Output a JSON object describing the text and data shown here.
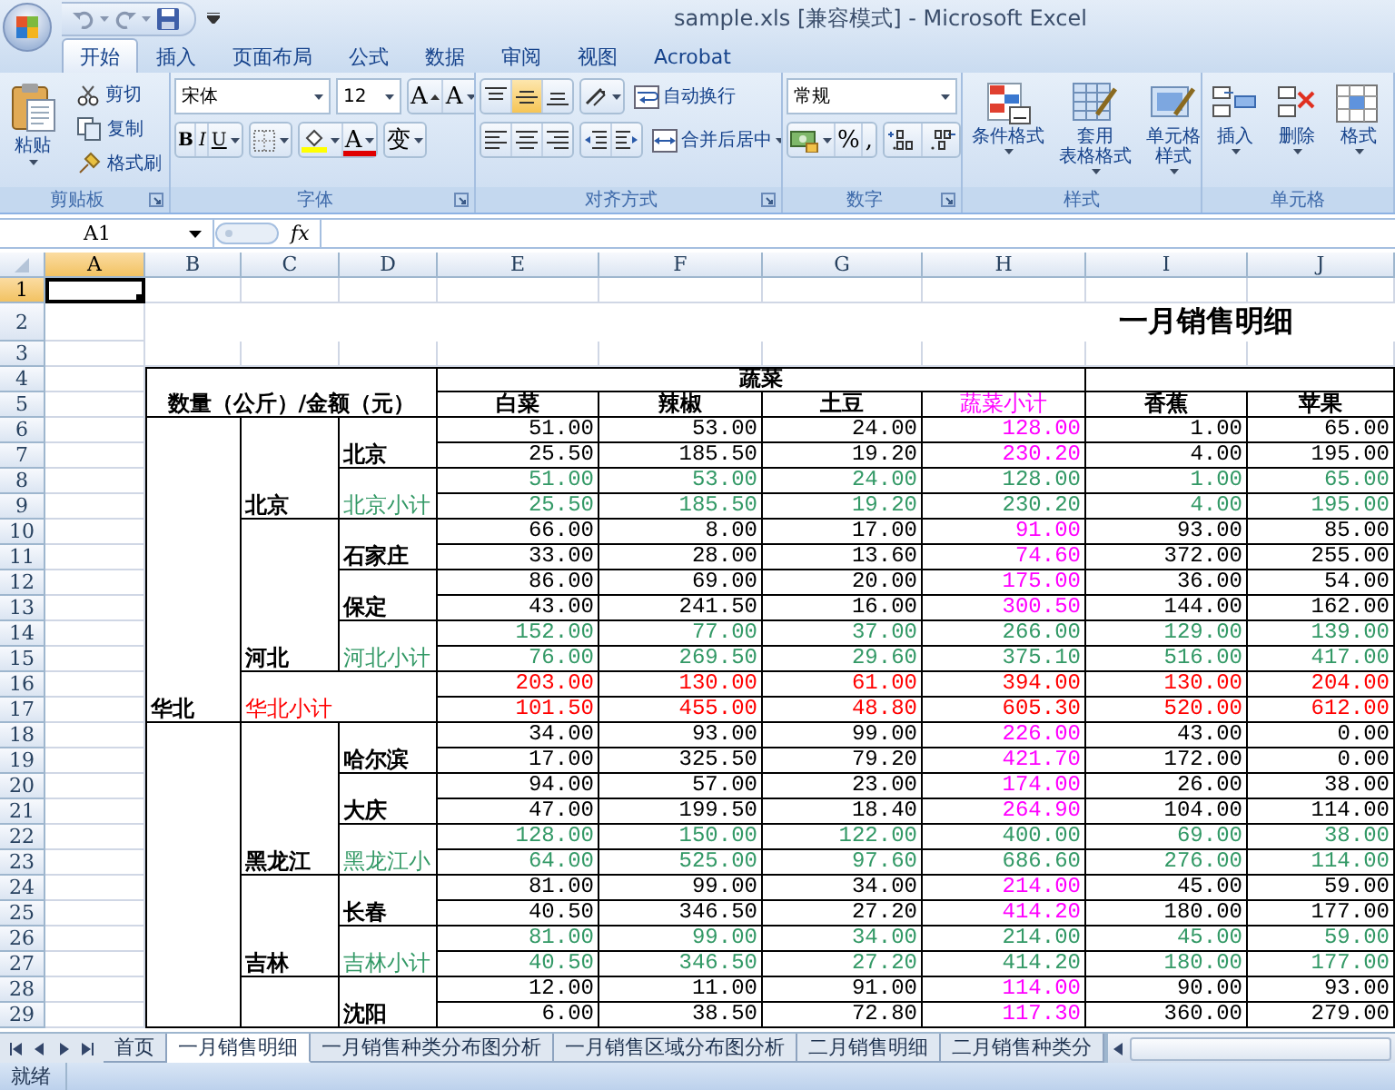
{
  "window": {
    "title": "sample.xls [兼容模式] - Microsoft Excel"
  },
  "ribbon_tabs": [
    {
      "label": "开始",
      "selected": true
    },
    {
      "label": "插入",
      "selected": false
    },
    {
      "label": "页面布局",
      "selected": false
    },
    {
      "label": "公式",
      "selected": false
    },
    {
      "label": "数据",
      "selected": false
    },
    {
      "label": "审阅",
      "selected": false
    },
    {
      "label": "视图",
      "selected": false
    },
    {
      "label": "Acrobat",
      "selected": false
    }
  ],
  "ribbon": {
    "groups": [
      {
        "kind": "clipboard",
        "label": "剪贴板",
        "launcher": true,
        "paste": "粘贴",
        "small": [
          "剪切",
          "复制",
          "格式刷"
        ]
      },
      {
        "kind": "font",
        "label": "字体",
        "launcher": true,
        "font_name": "宋体",
        "font_size": "12",
        "grow": "A",
        "shrink": "A",
        "bold": "B",
        "italic": "I",
        "underline": "U",
        "font_color": "A",
        "phonetic": "变"
      },
      {
        "kind": "alignment",
        "label": "对齐方式",
        "launcher": true,
        "vertical": [
          {
            "selected": false
          },
          {
            "selected": true
          },
          {
            "selected": false
          }
        ],
        "wrap": "自动换行",
        "merge": "合并后居中"
      },
      {
        "kind": "number",
        "label": "数字",
        "launcher": true,
        "format": "常规",
        "percent": "%",
        "comma": ","
      },
      {
        "kind": "styles",
        "label": "样式",
        "launcher": false,
        "buttons": [
          [
            "条件格式"
          ],
          [
            "套用",
            "表格格式"
          ],
          [
            "单元格",
            "样式"
          ]
        ]
      },
      {
        "kind": "cells",
        "label": "单元格",
        "launcher": false,
        "buttons": [
          [
            "插入"
          ],
          [
            "删除"
          ],
          [
            "格式"
          ]
        ]
      }
    ]
  },
  "formula_bar": {
    "name_box": "A1",
    "function_label": "fx"
  },
  "sheet": {
    "columns": [
      {
        "label": "A",
        "selected": true
      },
      {
        "label": "B",
        "selected": false
      },
      {
        "label": "C",
        "selected": false
      },
      {
        "label": "D",
        "selected": false
      },
      {
        "label": "E",
        "selected": false
      },
      {
        "label": "F",
        "selected": false
      },
      {
        "label": "G",
        "selected": false
      },
      {
        "label": "H",
        "selected": false
      },
      {
        "label": "I",
        "selected": false
      },
      {
        "label": "J",
        "selected": false
      }
    ],
    "rows": [
      {
        "label": "1",
        "selected": true
      },
      {
        "label": "2",
        "selected": false
      },
      {
        "label": "3",
        "selected": false
      },
      {
        "label": "4",
        "selected": false
      },
      {
        "label": "5",
        "selected": false
      },
      {
        "label": "6",
        "selected": false
      },
      {
        "label": "7",
        "selected": false
      },
      {
        "label": "8",
        "selected": false
      },
      {
        "label": "9",
        "selected": false
      },
      {
        "label": "10",
        "selected": false
      },
      {
        "label": "11",
        "selected": false
      },
      {
        "label": "12",
        "selected": false
      },
      {
        "label": "13",
        "selected": false
      },
      {
        "label": "14",
        "selected": false
      },
      {
        "label": "15",
        "selected": false
      },
      {
        "label": "16",
        "selected": false
      },
      {
        "label": "17",
        "selected": false
      },
      {
        "label": "18",
        "selected": false
      },
      {
        "label": "19",
        "selected": false
      },
      {
        "label": "20",
        "selected": false
      },
      {
        "label": "21",
        "selected": false
      },
      {
        "label": "22",
        "selected": false
      },
      {
        "label": "23",
        "selected": false
      },
      {
        "label": "24",
        "selected": false
      },
      {
        "label": "25",
        "selected": false
      },
      {
        "label": "26",
        "selected": false
      },
      {
        "label": "27",
        "selected": false
      },
      {
        "label": "28",
        "selected": false
      },
      {
        "label": "29",
        "selected": false
      }
    ],
    "title": "一月销售明细",
    "corner_label": "数量（公斤）/金额（元）",
    "product_groups": [
      {
        "label": "蔬菜"
      }
    ],
    "headers": [
      {
        "label": "白菜",
        "kind": "item"
      },
      {
        "label": "辣椒",
        "kind": "item"
      },
      {
        "label": "土豆",
        "kind": "item"
      },
      {
        "label": "蔬菜小计",
        "kind": "subtotal"
      },
      {
        "label": "香蕉",
        "kind": "item"
      },
      {
        "label": "苹果",
        "kind": "item"
      }
    ],
    "regions": [
      {
        "name": "华北",
        "provinces": [
          {
            "name": "北京",
            "cities": [
              {
                "name": "北京",
                "quantity": [
                  "51.00",
                  "53.00",
                  "24.00",
                  "128.00",
                  "1.00",
                  "65.00"
                ],
                "amount": [
                  "25.50",
                  "185.50",
                  "19.20",
                  "230.20",
                  "4.00",
                  "195.00"
                ]
              }
            ],
            "subtotal": {
              "label": "北京小计",
              "quantity": [
                "51.00",
                "53.00",
                "24.00",
                "128.00",
                "1.00",
                "65.00"
              ],
              "amount": [
                "25.50",
                "185.50",
                "19.20",
                "230.20",
                "4.00",
                "195.00"
              ]
            }
          },
          {
            "name": "河北",
            "cities": [
              {
                "name": "石家庄",
                "quantity": [
                  "66.00",
                  "8.00",
                  "17.00",
                  "91.00",
                  "93.00",
                  "85.00"
                ],
                "amount": [
                  "33.00",
                  "28.00",
                  "13.60",
                  "74.60",
                  "372.00",
                  "255.00"
                ]
              },
              {
                "name": "保定",
                "quantity": [
                  "86.00",
                  "69.00",
                  "20.00",
                  "175.00",
                  "36.00",
                  "54.00"
                ],
                "amount": [
                  "43.00",
                  "241.50",
                  "16.00",
                  "300.50",
                  "144.00",
                  "162.00"
                ]
              }
            ],
            "subtotal": {
              "label": "河北小计",
              "quantity": [
                "152.00",
                "77.00",
                "37.00",
                "266.00",
                "129.00",
                "139.00"
              ],
              "amount": [
                "76.00",
                "269.50",
                "29.60",
                "375.10",
                "516.00",
                "417.00"
              ]
            }
          }
        ],
        "total": {
          "label": "华北小计",
          "quantity": [
            "203.00",
            "130.00",
            "61.00",
            "394.00",
            "130.00",
            "204.00"
          ],
          "amount": [
            "101.50",
            "455.00",
            "48.80",
            "605.30",
            "520.00",
            "612.00"
          ]
        }
      },
      {
        "provinces": [
          {
            "name": "黑龙江",
            "cities": [
              {
                "name": "哈尔滨",
                "quantity": [
                  "34.00",
                  "93.00",
                  "99.00",
                  "226.00",
                  "43.00",
                  "0.00"
                ],
                "amount": [
                  "17.00",
                  "325.50",
                  "79.20",
                  "421.70",
                  "172.00",
                  "0.00"
                ]
              },
              {
                "name": "大庆",
                "quantity": [
                  "94.00",
                  "57.00",
                  "23.00",
                  "174.00",
                  "26.00",
                  "38.00"
                ],
                "amount": [
                  "47.00",
                  "199.50",
                  "18.40",
                  "264.90",
                  "104.00",
                  "114.00"
                ]
              }
            ],
            "subtotal": {
              "label": "黑龙江小",
              "quantity": [
                "128.00",
                "150.00",
                "122.00",
                "400.00",
                "69.00",
                "38.00"
              ],
              "amount": [
                "64.00",
                "525.00",
                "97.60",
                "686.60",
                "276.00",
                "114.00"
              ]
            }
          },
          {
            "name": "吉林",
            "cities": [
              {
                "name": "长春",
                "quantity": [
                  "81.00",
                  "99.00",
                  "34.00",
                  "214.00",
                  "45.00",
                  "59.00"
                ],
                "amount": [
                  "40.50",
                  "346.50",
                  "27.20",
                  "414.20",
                  "180.00",
                  "177.00"
                ]
              }
            ],
            "subtotal": {
              "label": "吉林小计",
              "quantity": [
                "81.00",
                "99.00",
                "34.00",
                "214.00",
                "45.00",
                "59.00"
              ],
              "amount": [
                "40.50",
                "346.50",
                "27.20",
                "414.20",
                "180.00",
                "177.00"
              ]
            }
          },
          {
            "cities": [
              {
                "name": "沈阳",
                "quantity": [
                  "12.00",
                  "11.00",
                  "91.00",
                  "114.00",
                  "90.00",
                  "93.00"
                ],
                "amount": [
                  "6.00",
                  "38.50",
                  "72.80",
                  "117.30",
                  "360.00",
                  "279.00"
                ]
              }
            ]
          }
        ]
      }
    ]
  },
  "sheet_tabs": [
    {
      "label": "首页",
      "selected": false
    },
    {
      "label": "一月销售明细",
      "selected": true
    },
    {
      "label": "一月销售种类分布图分析",
      "selected": false
    },
    {
      "label": "一月销售区域分布图分析",
      "selected": false
    },
    {
      "label": "二月销售明细",
      "selected": false
    },
    {
      "label": "二月销售种类分",
      "selected": false
    }
  ],
  "status_bar": {
    "text": "就绪"
  }
}
